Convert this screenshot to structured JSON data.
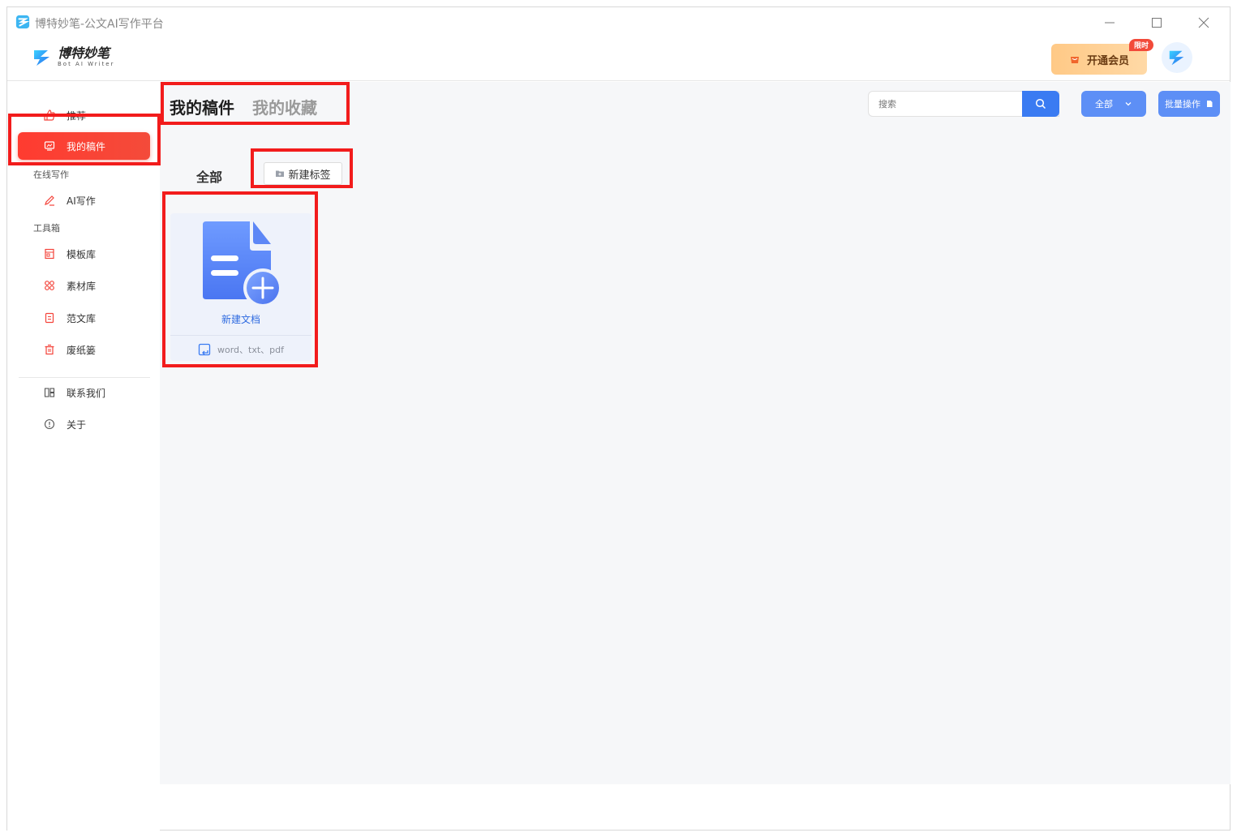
{
  "window": {
    "title": "博特妙笔-公文AI写作平台",
    "controls": {
      "minimize": "—",
      "maximize": "☐",
      "close": "✕"
    }
  },
  "header": {
    "brand_name": "博特妙笔",
    "brand_sub": "Bot AI Writer",
    "vip_label": "开通会员",
    "vip_badge": "限时"
  },
  "sidebar": {
    "items": [
      {
        "label": "推荐",
        "icon": "thumbs-up-icon"
      },
      {
        "label": "我的稿件",
        "icon": "monitor-icon",
        "active": true
      }
    ],
    "group_online": "在线写作",
    "online_items": [
      {
        "label": "AI写作",
        "icon": "pen-icon"
      }
    ],
    "group_tools": "工具箱",
    "tool_items": [
      {
        "label": "模板库",
        "icon": "template-icon"
      },
      {
        "label": "素材库",
        "icon": "grid-icon"
      },
      {
        "label": "范文库",
        "icon": "document-icon"
      },
      {
        "label": "废纸篓",
        "icon": "trash-icon"
      }
    ],
    "footer_items": [
      {
        "label": "联系我们",
        "icon": "contact-icon"
      },
      {
        "label": "关于",
        "icon": "info-icon"
      }
    ]
  },
  "main": {
    "tabs": [
      {
        "label": "我的稿件",
        "active": true
      },
      {
        "label": "我的收藏",
        "active": false
      }
    ],
    "search": {
      "placeholder": "搜索"
    },
    "filter_label": "全部",
    "batch_label": "批量操作",
    "tag_all": "全部",
    "new_tag_label": "新建标签",
    "new_doc": {
      "label": "新建文档",
      "formats": "word、txt、pdf"
    }
  },
  "colors": {
    "accent_red": "#f4433a",
    "primary_blue": "#3a7bf2",
    "annotation": "#f21c1c"
  }
}
